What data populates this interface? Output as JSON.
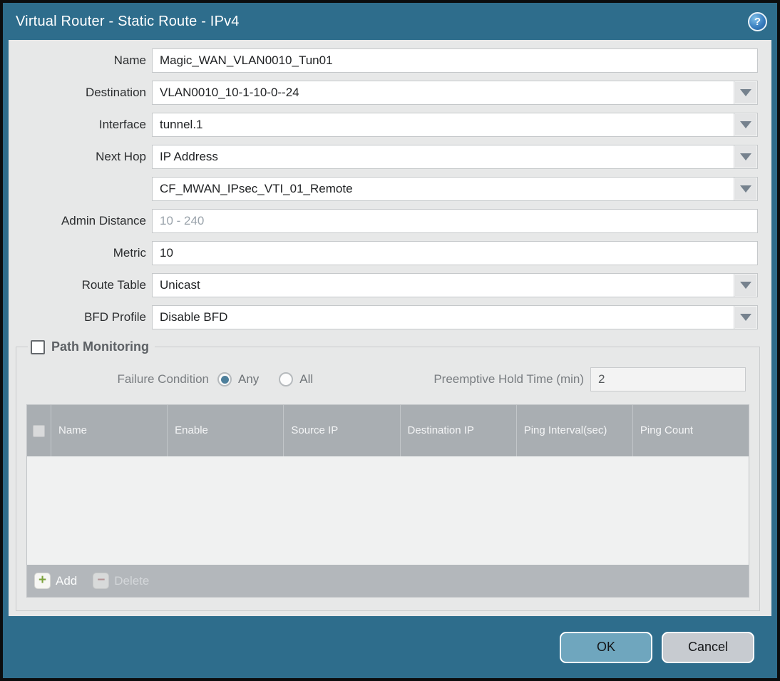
{
  "title": "Virtual Router - Static Route - IPv4",
  "help_icon_glyph": "?",
  "fields": {
    "name": {
      "label": "Name",
      "value": "Magic_WAN_VLAN0010_Tun01"
    },
    "destination": {
      "label": "Destination",
      "value": "VLAN0010_10-1-10-0--24"
    },
    "interface": {
      "label": "Interface",
      "value": "tunnel.1"
    },
    "next_hop": {
      "label": "Next Hop",
      "value": "IP Address"
    },
    "next_hop_address": {
      "value": "CF_MWAN_IPsec_VTI_01_Remote"
    },
    "admin_distance": {
      "label": "Admin Distance",
      "placeholder": "10 - 240",
      "value": ""
    },
    "metric": {
      "label": "Metric",
      "value": "10"
    },
    "route_table": {
      "label": "Route Table",
      "value": "Unicast"
    },
    "bfd_profile": {
      "label": "BFD Profile",
      "value": "Disable BFD"
    }
  },
  "path_monitoring": {
    "label": "Path Monitoring",
    "checked": false,
    "failure_condition": {
      "label": "Failure Condition",
      "options": [
        {
          "label": "Any",
          "selected": true
        },
        {
          "label": "All",
          "selected": false
        }
      ]
    },
    "preemptive_hold_time": {
      "label": "Preemptive Hold Time (min)",
      "value": "2"
    },
    "table": {
      "headers": [
        "Name",
        "Enable",
        "Source IP",
        "Destination IP",
        "Ping Interval(sec)",
        "Ping Count"
      ],
      "rows": []
    },
    "add_label": "Add",
    "delete_label": "Delete"
  },
  "footer": {
    "ok_label": "OK",
    "cancel_label": "Cancel"
  },
  "colors": {
    "titlebar": "#2e6d8c",
    "content_bg": "#e7e8e8",
    "table_header_bg": "#a9aeb2",
    "table_footer_bg": "#b3b7bb",
    "ok_button": "#6fa6be",
    "cancel_button": "#c7cbd0",
    "radio_selected": "#4d7f9b",
    "add_plus": "#7ca23c",
    "delete_minus": "#b5797a"
  }
}
